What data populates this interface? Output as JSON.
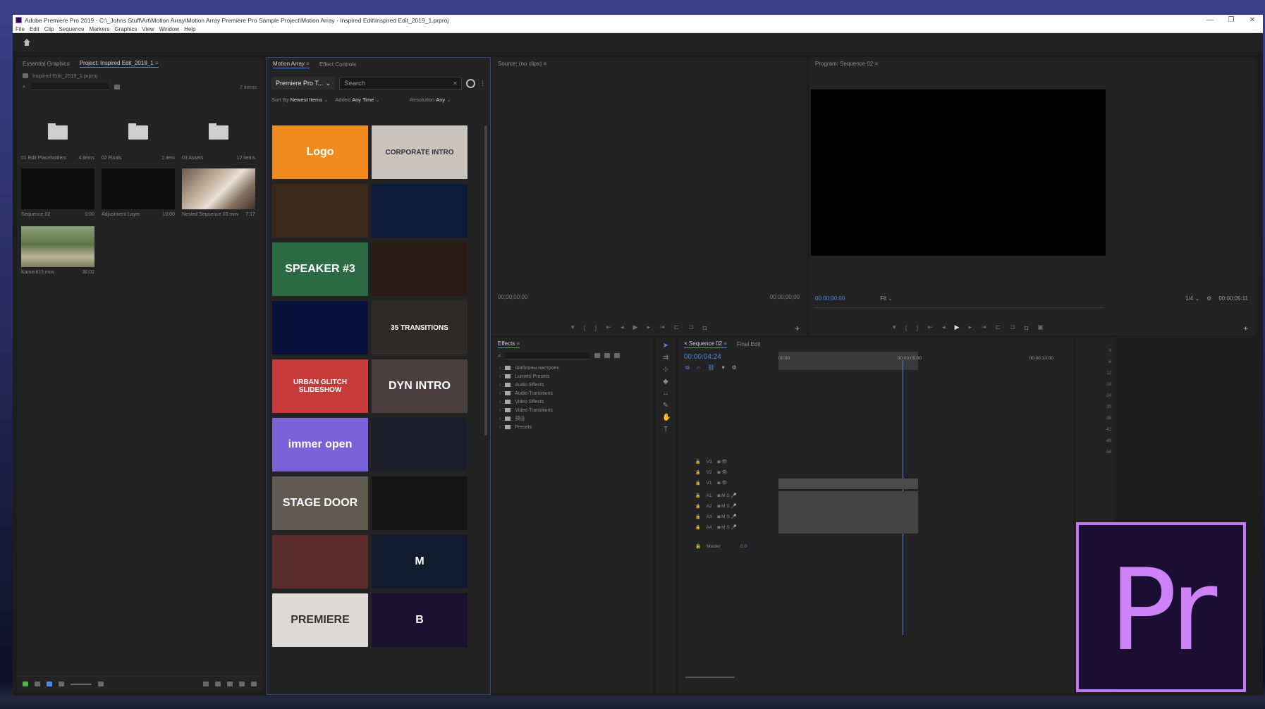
{
  "window": {
    "title": "Adobe Premiere Pro 2019 - C:\\_Johns Stuff\\Art\\Motion Array\\Motion Array Premiere Pro Sample Project\\Motion Array - Inspired Edit\\Inspired Edit_2019_1.prproj",
    "minimize": "—",
    "restore": "❐",
    "close": "✕"
  },
  "menu": [
    "File",
    "Edit",
    "Clip",
    "Sequence",
    "Markers",
    "Graphics",
    "View",
    "Window",
    "Help"
  ],
  "project_panel": {
    "tabs": [
      "Essential Graphics",
      "Project: Inspired Edit_2019_1"
    ],
    "hamburger": "≡",
    "path": "Inspired Edit_2019_1.prproj",
    "items_count": "7 items",
    "bins": [
      {
        "name": "01 Edit Placeholders",
        "meta": "4 items"
      },
      {
        "name": "02 Finals",
        "meta": "1 item"
      },
      {
        "name": "03 Assets",
        "meta": "12 items"
      },
      {
        "name": "Sequence 02",
        "meta": "0:00"
      },
      {
        "name": "Adjustment Layer",
        "meta": "10:00"
      },
      {
        "name": "Nested Sequence 03.mov",
        "meta": "7:17"
      },
      {
        "name": "Kamerit13.mov",
        "meta": "36:02"
      }
    ]
  },
  "motion_array": {
    "tabs": [
      "Motion Array",
      "Effect Controls"
    ],
    "hamburger": "≡",
    "category": "Premiere Pro T...",
    "search_placeholder": "Search",
    "search_clear": "×",
    "sort_label": "Sort By",
    "sort_value": "Newest Items",
    "added_label": "Added",
    "added_value": "Any Time",
    "resolution_label": "Resolution",
    "resolution_value": "Any",
    "tiles": [
      {
        "text": "Logo",
        "bg": "#f28b1e"
      },
      {
        "text": "CORPORATE INTRO",
        "bg": "#c9c3bd"
      },
      {
        "text": "",
        "bg": "#3b2a1c"
      },
      {
        "text": "",
        "bg": "#0e1a3a"
      },
      {
        "text": "SPEAKER #3",
        "bg": "#2b6a43"
      },
      {
        "text": "",
        "bg": "#2a1a14"
      },
      {
        "text": "",
        "bg": "#08123c"
      },
      {
        "text": "35 TRANSITIONS",
        "bg": "#2d2a27"
      },
      {
        "text": "URBAN GLITCH SLIDESHOW",
        "bg": "#c63a3a"
      },
      {
        "text": "DYN INTRO",
        "bg": "#4a4040"
      },
      {
        "text": "immer open",
        "bg": "#7a62d8"
      },
      {
        "text": "",
        "bg": "#1b1e2a"
      },
      {
        "text": "STAGE DOOR",
        "bg": "#5f5a52"
      },
      {
        "text": "",
        "bg": "#151515"
      },
      {
        "text": "",
        "bg": "#5a2c2c"
      },
      {
        "text": "M",
        "bg": "#101b2e"
      },
      {
        "text": "PREMIERE",
        "bg": "#dcdad6"
      },
      {
        "text": "B",
        "bg": "#1a1030"
      }
    ]
  },
  "source_monitor": {
    "title": "Source: (no clips)",
    "hamburger": "≡",
    "tc_in": "00;00;00;00",
    "tc_out": "00;00;00;00",
    "add": "+"
  },
  "program_monitor": {
    "title": "Program: Sequence 02",
    "hamburger": "≡",
    "tc": "00:00:00:00",
    "fit": "Fit",
    "ratio": "1/4",
    "duration": "00:00:05:11",
    "add": "+"
  },
  "effects_panel": {
    "title": "Effects",
    "hamburger": "≡",
    "tree": [
      "Шаблоны настроек",
      "Lumetri Presets",
      "Audio Effects",
      "Audio Transitions",
      "Video Effects",
      "Video Transitions",
      "预设",
      "Presets"
    ]
  },
  "timeline": {
    "tabs": [
      "Sequence 02",
      "Final Edit"
    ],
    "hamburger": "≡",
    "tc": "00:00:04:24",
    "ruler": [
      "00:00",
      "00:00:05:00",
      "00:00:10:00"
    ],
    "tracks": [
      "V3",
      "V2",
      "V1",
      "A1",
      "A2",
      "A3",
      "A4"
    ],
    "master": "Master",
    "master_val": "0.0"
  },
  "meter_scale": [
    "0",
    "-6",
    "-12",
    "-18",
    "-24",
    "-30",
    "-36",
    "-42",
    "-48",
    "-54"
  ],
  "logo": "Pr",
  "colors": {
    "accent": "#4a8ae8",
    "pr_purple": "#c377f2",
    "pr_bg": "#1a0f33"
  }
}
